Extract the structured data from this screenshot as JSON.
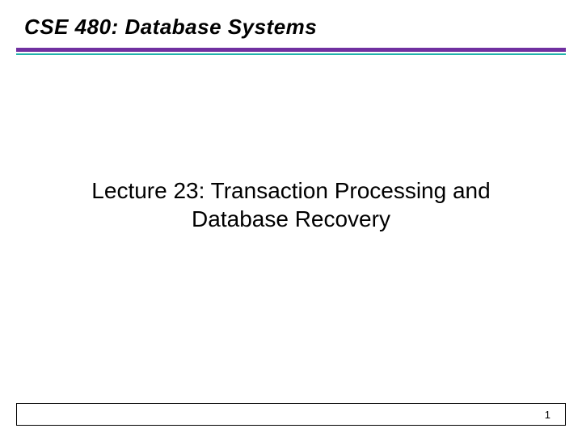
{
  "header": {
    "course_title": "CSE 480: Database Systems"
  },
  "content": {
    "lecture_title": "Lecture 23: Transaction Processing and Database Recovery"
  },
  "footer": {
    "page_number": "1"
  }
}
